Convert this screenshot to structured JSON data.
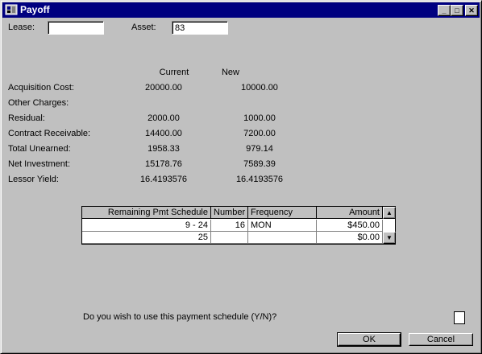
{
  "window": {
    "title": "Payoff",
    "min_glyph": "_",
    "max_glyph": "□",
    "close_glyph": "✕"
  },
  "lease": {
    "label": "Lease:",
    "value": ""
  },
  "asset": {
    "label": "Asset:",
    "value": "83"
  },
  "columns": {
    "current": "Current",
    "new": "New"
  },
  "rows": [
    {
      "label": "Acquisition Cost:",
      "current": "20000.00",
      "new": "10000.00"
    },
    {
      "label": "Other Charges:",
      "current": "",
      "new": ""
    },
    {
      "label": "Residual:",
      "current": "2000.00",
      "new": "1000.00"
    },
    {
      "label": "Contract Receivable:",
      "current": "14400.00",
      "new": "7200.00"
    },
    {
      "label": "Total Unearned:",
      "current": "1958.33",
      "new": "979.14"
    },
    {
      "label": "Net Investment:",
      "current": "15178.76",
      "new": "7589.39"
    },
    {
      "label": "Lessor Yield:",
      "current": "16.4193576",
      "new": "16.4193576"
    }
  ],
  "schedule": {
    "headers": [
      "Remaining Pmt Schedule",
      "Number",
      "Frequency",
      "Amount"
    ],
    "rows": [
      [
        "9 -  24",
        "16",
        "MON",
        "$450.00"
      ],
      [
        "25",
        "",
        "",
        "$0.00"
      ]
    ],
    "scroll_up": "▲",
    "scroll_down": "▼"
  },
  "question": "Do you wish to use this payment schedule (Y/N)?",
  "buttons": {
    "ok": "OK",
    "cancel": "Cancel"
  }
}
